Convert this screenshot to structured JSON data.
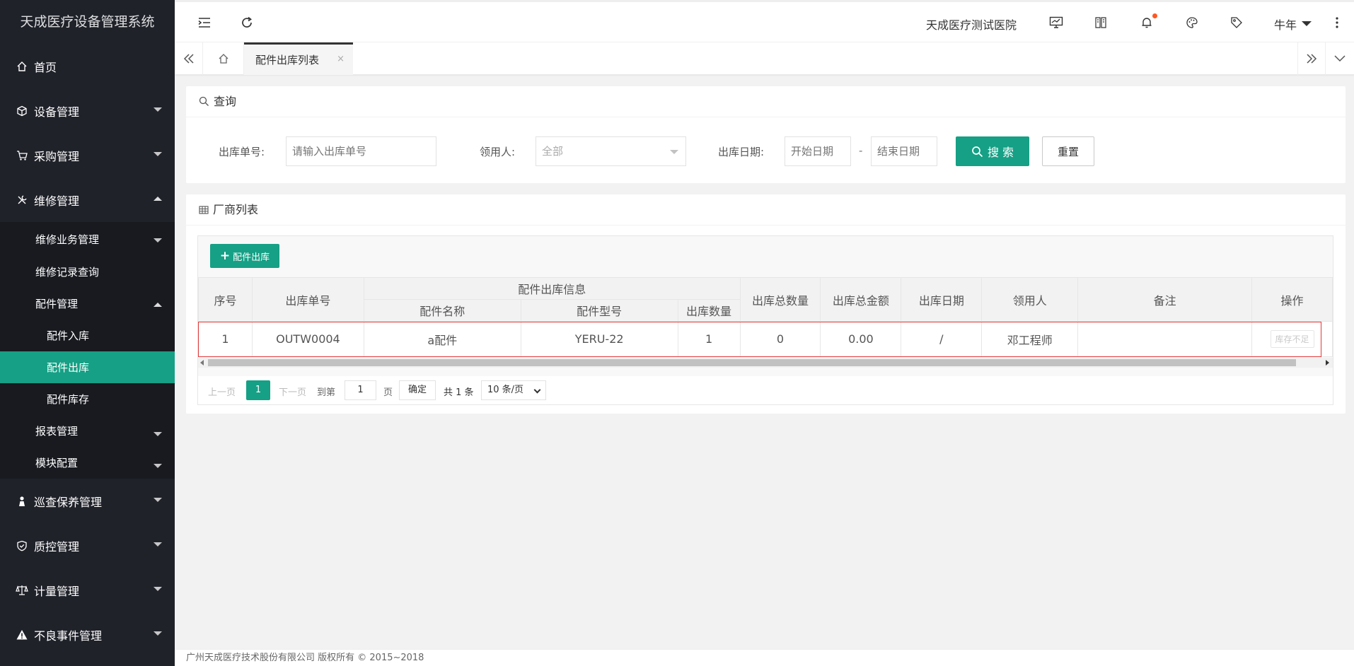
{
  "app": {
    "title": "天成医疗设备管理系统"
  },
  "sidebar": {
    "home": "首页",
    "equipment": "设备管理",
    "purchase": "采购管理",
    "repair": "维修管理",
    "repair_sub": {
      "business": "维修业务管理",
      "records": "维修记录查询",
      "parts": "配件管理",
      "parts_in": "配件入库",
      "parts_out": "配件出库",
      "parts_stock": "配件库存",
      "report": "报表管理",
      "module": "模块配置"
    },
    "inspection": "巡查保养管理",
    "quality": "质控管理",
    "metering": "计量管理",
    "adverse": "不良事件管理"
  },
  "header": {
    "hospital": "天成医疗测试医院",
    "user": "牛年"
  },
  "tabs": {
    "active": "配件出库列表",
    "close": "×"
  },
  "query": {
    "title": "查询",
    "order_label": "出库单号:",
    "order_placeholder": "请输入出库单号",
    "receiver_label": "领用人:",
    "receiver_value": "全部",
    "date_label": "出库日期:",
    "start_placeholder": "开始日期",
    "dash": "-",
    "end_placeholder": "结束日期",
    "search": "搜 索",
    "reset": "重置"
  },
  "list": {
    "title": "厂商列表",
    "add_button": "配件出库",
    "headers": {
      "index": "序号",
      "order_no": "出库单号",
      "info_group": "配件出库信息",
      "part_name": "配件名称",
      "part_model": "配件型号",
      "qty": "出库数量",
      "total_qty": "出库总数量",
      "total_amount": "出库总金额",
      "date": "出库日期",
      "receiver": "领用人",
      "remark": "备注",
      "action": "操作"
    },
    "rows": [
      {
        "index": "1",
        "order_no": "OUTW0004",
        "part_name": "a配件",
        "part_model": "YERU-22",
        "qty": "1",
        "total_qty": "0",
        "total_amount": "0.00",
        "date": "/",
        "receiver": "邓工程师",
        "remark": "",
        "action": "库存不足"
      }
    ]
  },
  "pager": {
    "prev": "上一页",
    "current": "1",
    "next": "下一页",
    "goto": "到第",
    "page_value": "1",
    "page_unit": "页",
    "confirm": "确定",
    "total": "共 1 条",
    "size": "10 条/页"
  },
  "footer": {
    "text": "广州天成医疗技术股份有限公司 版权所有 © 2015~2018"
  },
  "colors": {
    "accent": "#16a085",
    "sidebar": "#20222a",
    "highlight": "#e03b3b",
    "badge": "#ff5722"
  }
}
